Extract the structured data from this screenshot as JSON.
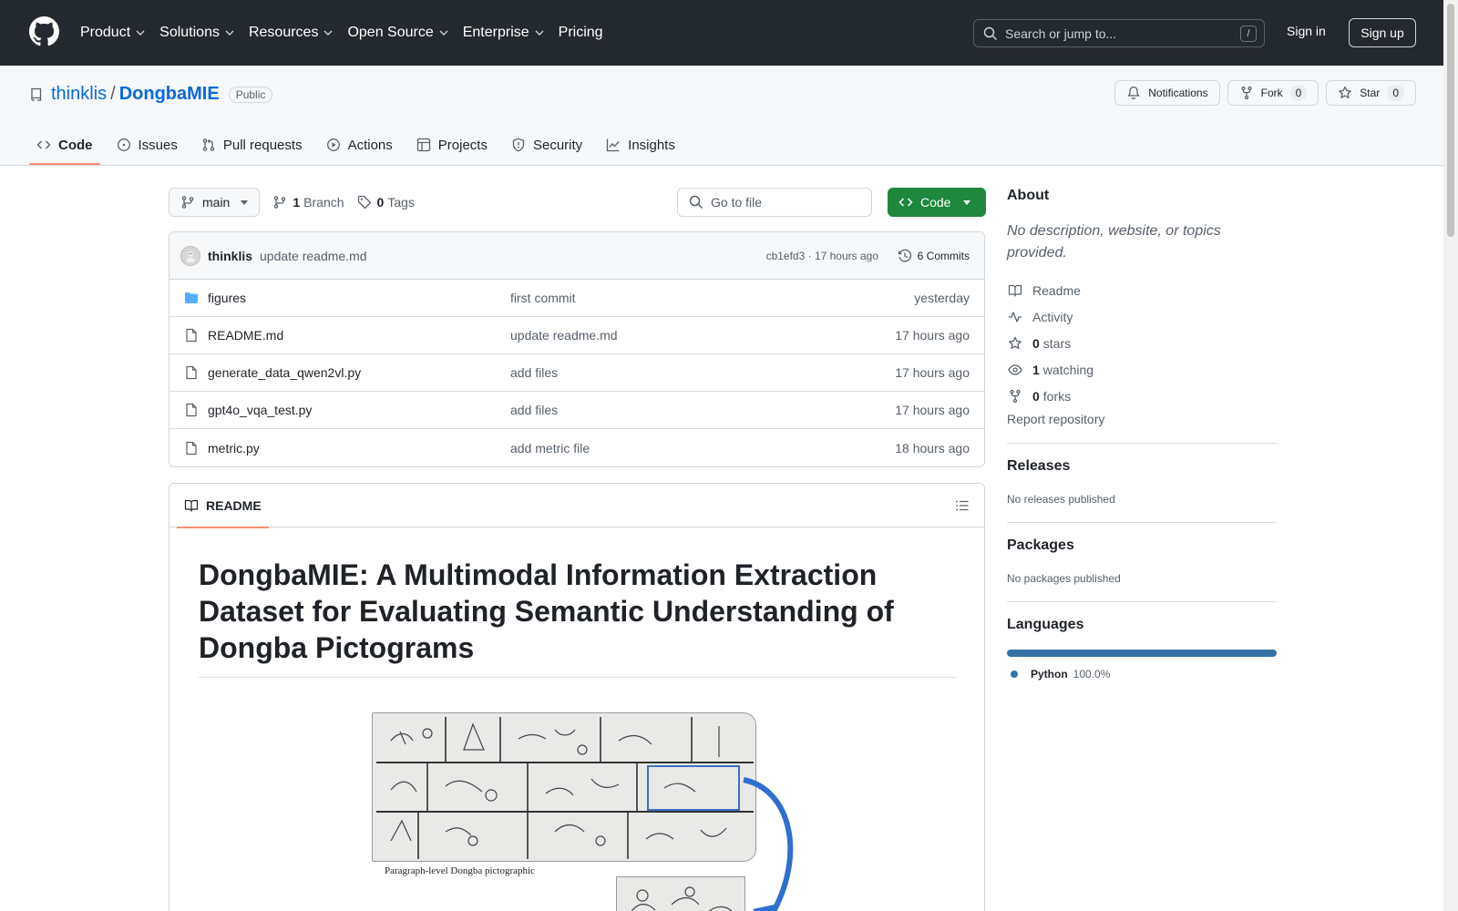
{
  "topnav": {
    "items": [
      {
        "label": "Product",
        "chevron": true
      },
      {
        "label": "Solutions",
        "chevron": true
      },
      {
        "label": "Resources",
        "chevron": true
      },
      {
        "label": "Open Source",
        "chevron": true
      },
      {
        "label": "Enterprise",
        "chevron": true
      },
      {
        "label": "Pricing",
        "chevron": false
      }
    ],
    "search_placeholder": "Search or jump to...",
    "search_shortcut": "/",
    "signin": "Sign in",
    "signup": "Sign up"
  },
  "repo": {
    "owner": "thinklis",
    "separator": "/",
    "name": "DongbaMIE",
    "visibility": "Public",
    "notifications_label": "Notifications",
    "fork_label": "Fork",
    "fork_count": "0",
    "star_label": "Star",
    "star_count": "0",
    "tabs": [
      {
        "label": "Code",
        "icon": "code-icon",
        "active": true
      },
      {
        "label": "Issues",
        "icon": "issue-icon",
        "active": false
      },
      {
        "label": "Pull requests",
        "icon": "pull-request-icon",
        "active": false
      },
      {
        "label": "Actions",
        "icon": "play-icon",
        "active": false
      },
      {
        "label": "Projects",
        "icon": "table-icon",
        "active": false
      },
      {
        "label": "Security",
        "icon": "shield-icon",
        "active": false
      },
      {
        "label": "Insights",
        "icon": "graph-icon",
        "active": false
      }
    ]
  },
  "toolbar": {
    "branch": "main",
    "branch_count": "1",
    "branch_label": "Branch",
    "tag_count": "0",
    "tag_label": "Tags",
    "goto_file_placeholder": "Go to file",
    "code_button": "Code"
  },
  "latest_commit": {
    "author": "thinklis",
    "message": "update readme.md",
    "meta": "cb1efd3 · 17 hours ago",
    "commits_label": "6 Commits"
  },
  "files": [
    {
      "type": "folder",
      "name": "figures",
      "commit": "first commit",
      "time": "yesterday"
    },
    {
      "type": "file",
      "name": "README.md",
      "commit": "update readme.md",
      "time": "17 hours ago"
    },
    {
      "type": "file",
      "name": "generate_data_qwen2vl.py",
      "commit": "add files",
      "time": "17 hours ago"
    },
    {
      "type": "file",
      "name": "gpt4o_vqa_test.py",
      "commit": "add files",
      "time": "17 hours ago"
    },
    {
      "type": "file",
      "name": "metric.py",
      "commit": "add metric file",
      "time": "18 hours ago"
    }
  ],
  "readme": {
    "tab_label": "README",
    "title": "DongbaMIE: A Multimodal Information Extraction Dataset for Evaluating Semantic Understanding of Dongba Pictograms",
    "figure_caption": "Paragraph-level Dongba pictographic"
  },
  "sidebar": {
    "about_title": "About",
    "about_desc": "No description, website, or topics provided.",
    "items": [
      {
        "icon": "book-icon",
        "count": "",
        "label": "Readme"
      },
      {
        "icon": "pulse-icon",
        "count": "",
        "label": "Activity"
      },
      {
        "icon": "star-icon",
        "count": "0",
        "label": "stars"
      },
      {
        "icon": "eye-icon",
        "count": "1",
        "label": "watching"
      },
      {
        "icon": "fork-icon",
        "count": "0",
        "label": "forks"
      }
    ],
    "report": "Report repository",
    "releases_title": "Releases",
    "releases_text": "No releases published",
    "packages_title": "Packages",
    "packages_text": "No packages published",
    "languages_title": "Languages",
    "languages": [
      {
        "name": "Python",
        "percent": "100.0%",
        "color": "#3572A5"
      }
    ]
  },
  "colors": {
    "header_bg": "#24292f",
    "link": "#0969da",
    "primary_button": "#1f883d",
    "active_tab_underline": "#fd8c73",
    "folder": "#54aeff"
  }
}
